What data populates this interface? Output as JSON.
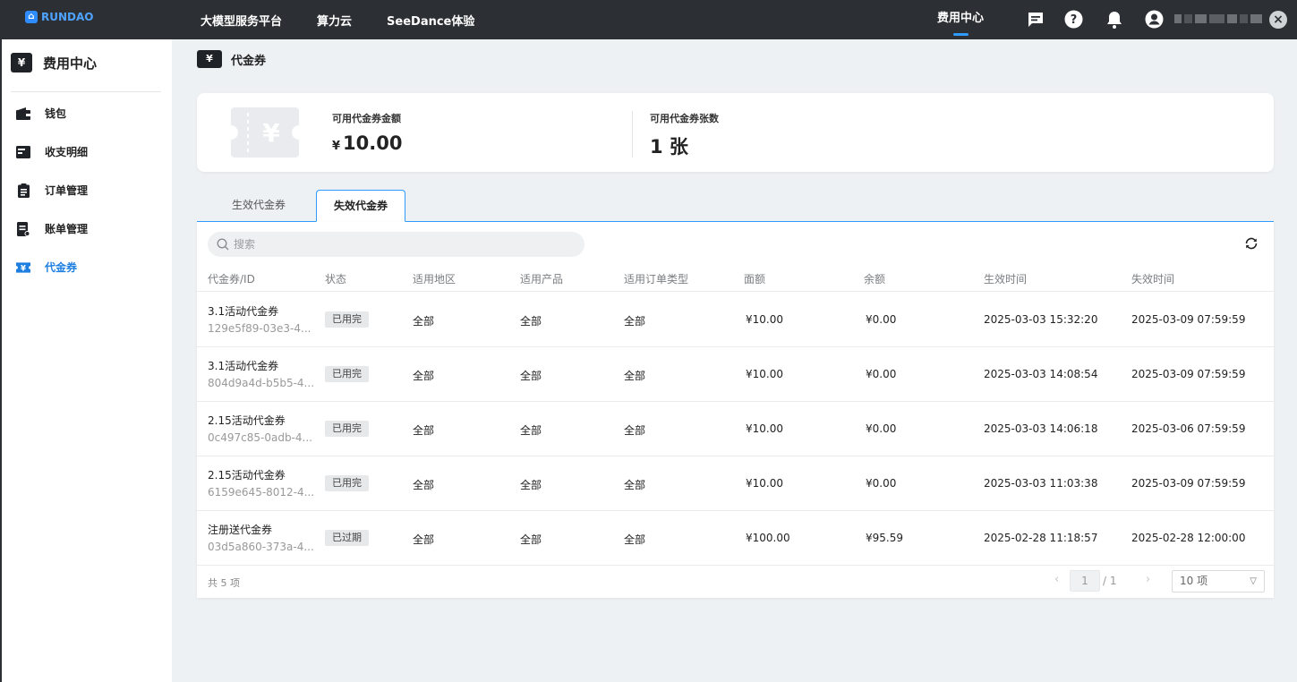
{
  "brand": {
    "name": "RUNDAO"
  },
  "topnav": {
    "items": [
      "大模型服务平台",
      "算力云",
      "SeeDance体验"
    ],
    "active": "费用中心"
  },
  "sidebar": {
    "title": "费用中心",
    "items": [
      {
        "label": "钱包",
        "icon": "wallet-icon"
      },
      {
        "label": "收支明细",
        "icon": "transactions-icon"
      },
      {
        "label": "订单管理",
        "icon": "clipboard-icon"
      },
      {
        "label": "账单管理",
        "icon": "bill-icon"
      },
      {
        "label": "代金券",
        "icon": "voucher-icon",
        "active": true
      }
    ]
  },
  "page": {
    "title": "代金券"
  },
  "summary": {
    "amount_label": "可用代金券金额",
    "currency": "¥",
    "amount_value": "10.00",
    "count_label": "可用代金券张数",
    "count_value": "1 张"
  },
  "tabs": [
    {
      "label": "生效代金券",
      "active": false
    },
    {
      "label": "失效代金券",
      "active": true
    }
  ],
  "search": {
    "placeholder": "搜索"
  },
  "table": {
    "columns": [
      "代金券/ID",
      "状态",
      "适用地区",
      "适用产品",
      "适用订单类型",
      "面额",
      "余额",
      "生效时间",
      "失效时间"
    ],
    "rows": [
      {
        "name": "3.1活动代金券",
        "id": "129e5f89-03e3-4...",
        "status": "已用完",
        "region": "全部",
        "product": "全部",
        "order_type": "全部",
        "face": "¥10.00",
        "balance": "¥0.00",
        "start": "2025-03-03 15:32:20",
        "end": "2025-03-09 07:59:59"
      },
      {
        "name": "3.1活动代金券",
        "id": "804d9a4d-b5b5-4...",
        "status": "已用完",
        "region": "全部",
        "product": "全部",
        "order_type": "全部",
        "face": "¥10.00",
        "balance": "¥0.00",
        "start": "2025-03-03 14:08:54",
        "end": "2025-03-09 07:59:59"
      },
      {
        "name": "2.15活动代金券",
        "id": "0c497c85-0adb-4...",
        "status": "已用完",
        "region": "全部",
        "product": "全部",
        "order_type": "全部",
        "face": "¥10.00",
        "balance": "¥0.00",
        "start": "2025-03-03 14:06:18",
        "end": "2025-03-06 07:59:59"
      },
      {
        "name": "2.15活动代金券",
        "id": "6159e645-8012-4...",
        "status": "已用完",
        "region": "全部",
        "product": "全部",
        "order_type": "全部",
        "face": "¥10.00",
        "balance": "¥0.00",
        "start": "2025-03-03 11:03:38",
        "end": "2025-03-09 07:59:59"
      },
      {
        "name": "注册送代金券",
        "id": "03d5a860-373a-4...",
        "status": "已过期",
        "region": "全部",
        "product": "全部",
        "order_type": "全部",
        "face": "¥100.00",
        "balance": "¥95.59",
        "start": "2025-02-28 11:18:57",
        "end": "2025-02-28 12:00:00"
      }
    ]
  },
  "pagination": {
    "total": "共 5 项",
    "current": "1",
    "pages": "/ 1",
    "page_size": "10 项"
  },
  "colors": {
    "accent": "#2f9bff",
    "topbar": "#2c2f33",
    "active_link": "#1e7fe0"
  }
}
